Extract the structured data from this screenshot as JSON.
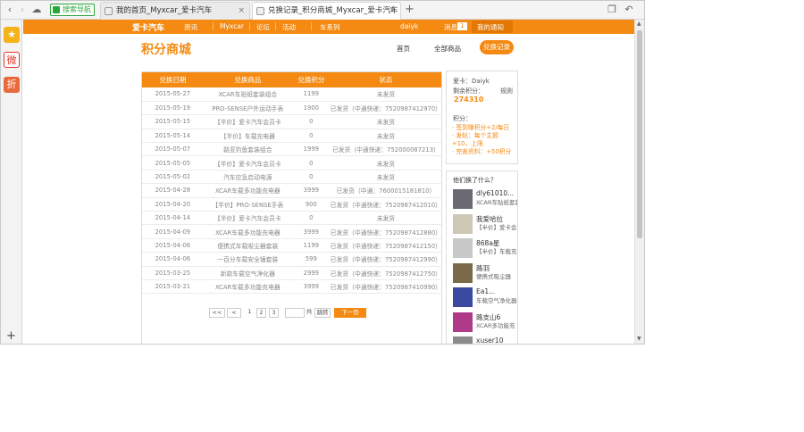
{
  "browser": {
    "fav_tab": "搜索导航",
    "tabs": [
      {
        "title": "我的首页_Myxcar_爱卡汽车",
        "active": false
      },
      {
        "title": "兑换记录_积分商城_Myxcar_爱卡汽车",
        "active": true
      }
    ],
    "new_tab": "+"
  },
  "sidebar": {
    "items": [
      {
        "icon": "star-icon",
        "color": "#f5b21b",
        "glyph": "★"
      },
      {
        "icon": "weibo-icon",
        "color": "#e6332a",
        "glyph": "微"
      },
      {
        "icon": "discount-icon",
        "color": "#e8693a",
        "glyph": "折"
      }
    ],
    "add": "+"
  },
  "topnav": {
    "logo": "爱卡汽车",
    "items": [
      "资讯",
      "Myxcar",
      "论坛",
      "活动",
      "车系列"
    ],
    "user": "daiyk",
    "msg_label": "消息",
    "msg_count": "1",
    "notif_label": "我的通知"
  },
  "header": {
    "brand": "积分商城",
    "links": [
      "首页",
      "全部商品"
    ],
    "button": "兑换记录"
  },
  "table": {
    "columns": [
      "兑换日期",
      "兑换商品",
      "兑换积分",
      "状态"
    ],
    "rows": [
      [
        "2015-05-27",
        "XCAR车贴纸套装组合",
        "1199",
        "未发货"
      ],
      [
        "2015-05-19",
        "PRO-SENSE户外运动手表",
        "1900",
        "已发货（中通快递：7520987412970）"
      ],
      [
        "2015-05-15",
        "【半价】爱卡汽车会员卡",
        "0",
        "未发货"
      ],
      [
        "2015-05-14",
        "【半价】车载充电器",
        "0",
        "未发货"
      ],
      [
        "2015-05-07",
        "路亚钓鱼套装组合",
        "1999",
        "已发货（中通快递：752000087213）"
      ],
      [
        "2015-05-05",
        "【半价】爱卡汽车会员卡",
        "0",
        "未发货"
      ],
      [
        "2015-05-02",
        "汽车应急启动电源",
        "0",
        "未发货"
      ],
      [
        "2015-04-28",
        "XCAR车载多功能充电器",
        "3999",
        "已发货（中通：7600015181810）"
      ],
      [
        "2015-04-20",
        "【半价】PRO-SENSE手表",
        "900",
        "已发货（中通快递：7520987412010）"
      ],
      [
        "2015-04-14",
        "【半价】爱卡汽车会员卡",
        "0",
        "未发货"
      ],
      [
        "2015-04-09",
        "XCAR车载多功能充电器",
        "3999",
        "已发货（中通快递：7520987412880）"
      ],
      [
        "2015-04-06",
        "便携式车载吸尘器套装",
        "1199",
        "已发货（中通快递：7520987412150）"
      ],
      [
        "2015-04-06",
        "一百分车载安全锤套装",
        "599",
        "已发货（中通快递：7520987412990）"
      ],
      [
        "2015-03-25",
        "新款车载空气净化器",
        "2999",
        "已发货（中通快递：7520987412750）"
      ],
      [
        "2015-03-21",
        "XCAR车载多功能充电器",
        "3999",
        "已发货（中通快递：7520987410990）"
      ]
    ]
  },
  "pager": {
    "prev": "<<",
    "prev2": "<",
    "pages": [
      "1",
      "2",
      "3"
    ],
    "total": "共",
    "go": "跳转",
    "next": "下一页"
  },
  "profile": {
    "title": "爱卡：Daiyk",
    "points_label": "剩余积分：",
    "rules": "规则",
    "points": "274310",
    "ways_label": "积分：",
    "ways": [
      "· 签到赚积分+2/每日",
      "· 发帖：每个主题+10，上限",
      "· 完善资料：+50积分"
    ]
  },
  "recent": {
    "title": "他们换了什么？",
    "items": [
      {
        "name": "dly61010...",
        "desc": "XCAR车贴纸套装",
        "color": "#6a6a72"
      },
      {
        "name": "我爱哈拉",
        "desc": "【半价】爱卡会员",
        "color": "#cfc7b6"
      },
      {
        "name": "868a星",
        "desc": "【半价】车载充电",
        "color": "#c8c8c8"
      },
      {
        "name": "路羽",
        "desc": "便携式吸尘器",
        "color": "#7a6a4a"
      },
      {
        "name": "Ea1...",
        "desc": "车载空气净化器",
        "color": "#3a4aa0"
      },
      {
        "name": "路支山6",
        "desc": "XCAR多功能充",
        "color": "#b03a8a"
      },
      {
        "name": "xuser10",
        "desc": "",
        "color": "#8a8a8a"
      }
    ]
  }
}
